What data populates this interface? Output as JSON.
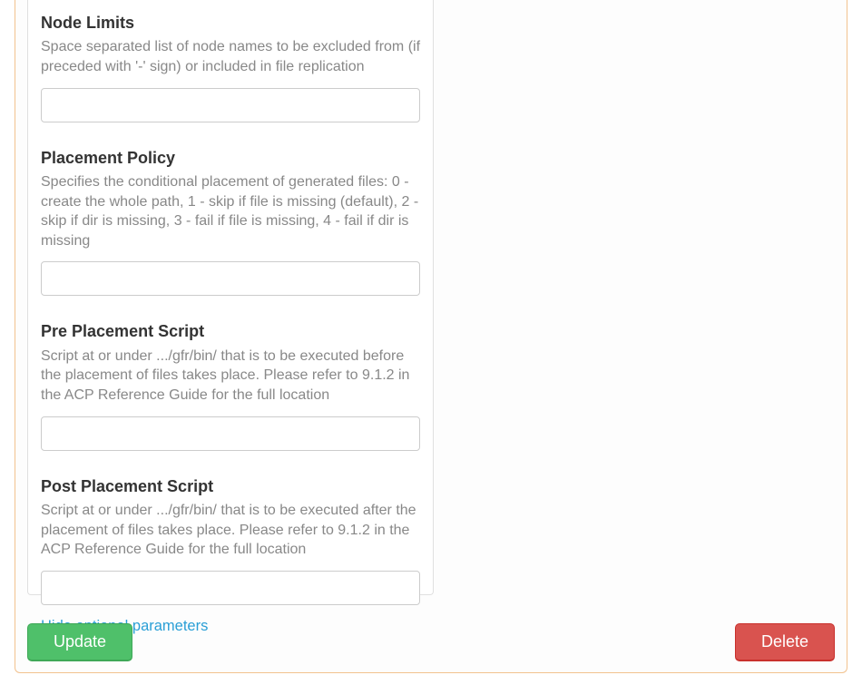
{
  "form": {
    "fields": [
      {
        "label": "Node Limits",
        "description": "Space separated list of node names to be excluded from (if preceded with '-' sign) or included in file replication",
        "value": ""
      },
      {
        "label": "Placement Policy",
        "description": "Specifies the conditional placement of generated files: 0 - create the whole path, 1 - skip if file is missing (default), 2 - skip if dir is missing, 3 - fail if file is missing, 4 - fail if dir is missing",
        "value": ""
      },
      {
        "label": "Pre Placement Script",
        "description": "Script at or under .../gfr/bin/ that is to be executed before the placement of files takes place. Please refer to 9.1.2 in the ACP Reference Guide for the full location",
        "value": ""
      },
      {
        "label": "Post Placement Script",
        "description": "Script at or under .../gfr/bin/ that is to be executed after the placement of files takes place. Please refer to 9.1.2 in the ACP Reference Guide for the full location",
        "value": ""
      }
    ],
    "toggle_label": "Hide optional parameters"
  },
  "buttons": {
    "update": "Update",
    "delete": "Delete"
  }
}
